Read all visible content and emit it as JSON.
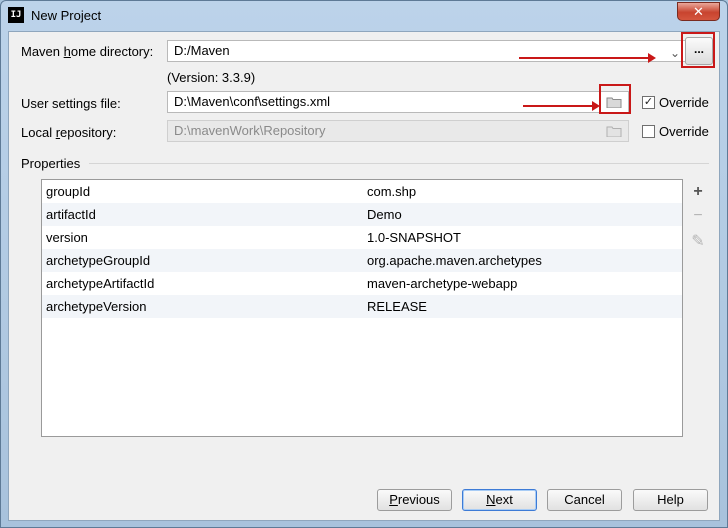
{
  "window": {
    "title": "New Project",
    "app_icon": "IJ",
    "close_glyph": "✕"
  },
  "maven_home": {
    "label_prefix": "Maven ",
    "label_mnemonic": "h",
    "label_suffix": "ome directory:",
    "value": "D:/Maven",
    "version": "(Version: 3.3.9)",
    "browse_label": "..."
  },
  "user_settings": {
    "label": "User settings file:",
    "value": "D:\\Maven\\conf\\settings.xml",
    "override_label": "Override",
    "override_checked": true
  },
  "local_repo": {
    "label_prefix": "Local ",
    "label_mnemonic": "r",
    "label_suffix": "epository:",
    "value": "D:\\mavenWork\\Repository",
    "override_label": "Override",
    "override_checked": false
  },
  "properties": {
    "title": "Properties",
    "rows": [
      {
        "key": "groupId",
        "value": "com.shp"
      },
      {
        "key": "artifactId",
        "value": "Demo"
      },
      {
        "key": "version",
        "value": "1.0-SNAPSHOT"
      },
      {
        "key": "archetypeGroupId",
        "value": "org.apache.maven.archetypes"
      },
      {
        "key": "archetypeArtifactId",
        "value": "maven-archetype-webapp"
      },
      {
        "key": "archetypeVersion",
        "value": "RELEASE"
      }
    ],
    "tools": {
      "add": "+",
      "remove": "−",
      "edit": "✎"
    }
  },
  "buttons": {
    "previous_mnemonic": "P",
    "previous_rest": "revious",
    "next_mnemonic": "N",
    "next_rest": "ext",
    "cancel": "Cancel",
    "help": "Help"
  },
  "colors": {
    "annotation_red": "#c91818",
    "focus_blue": "#3d7bd6"
  },
  "icons": [
    "folder-icon",
    "chevron-down-icon",
    "checkbox-icon",
    "plus-icon",
    "minus-icon",
    "pencil-icon"
  ]
}
